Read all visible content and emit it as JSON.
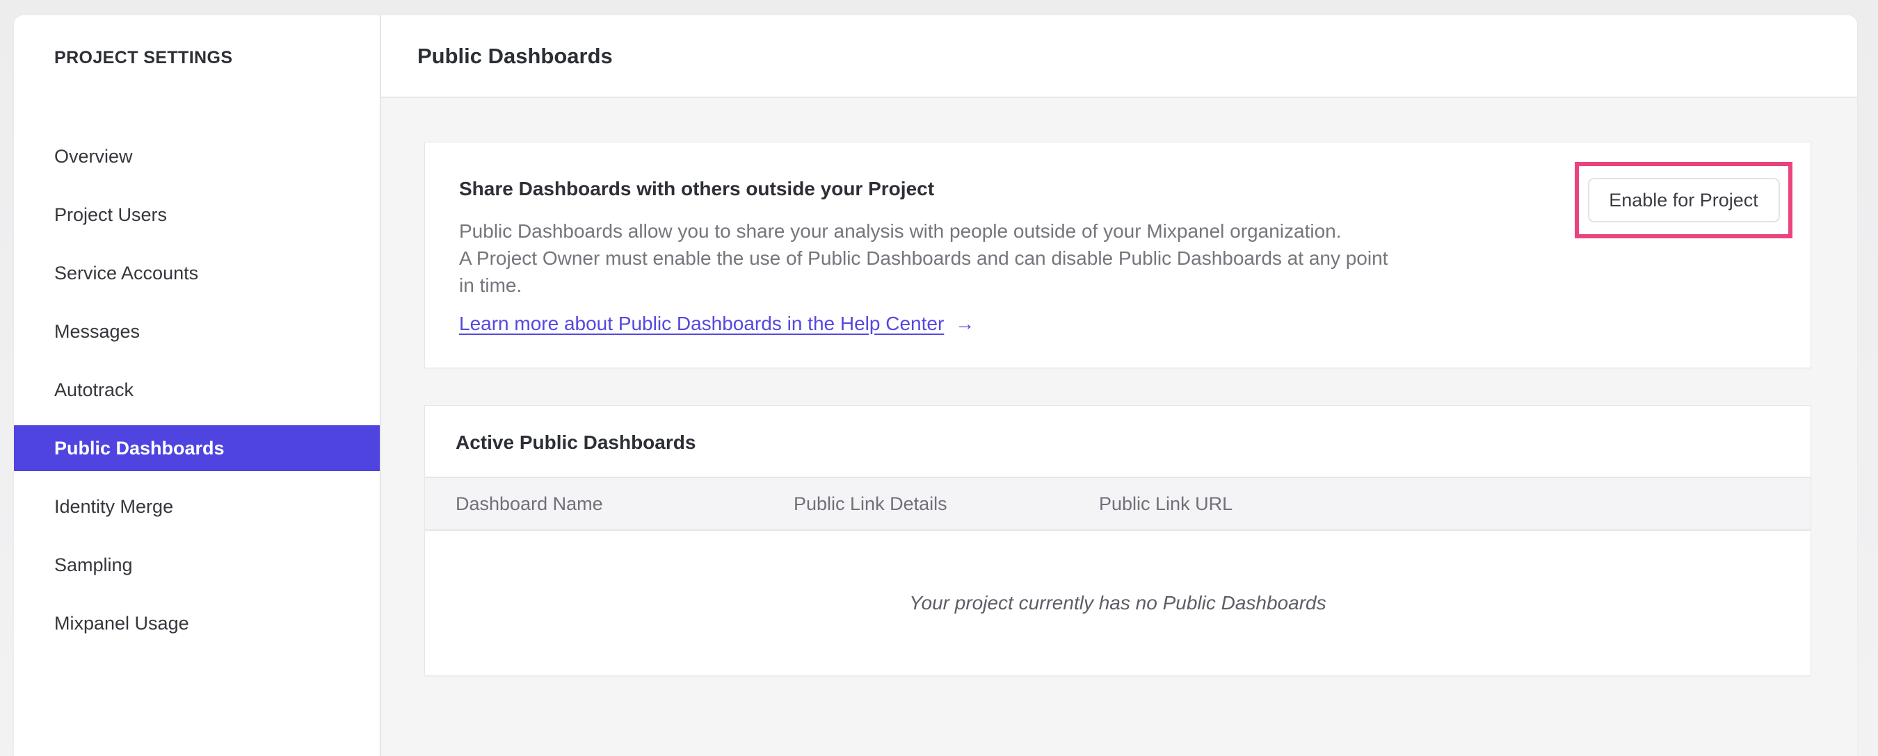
{
  "sidebar": {
    "title": "PROJECT SETTINGS",
    "items": [
      {
        "label": "Overview",
        "active": false
      },
      {
        "label": "Project Users",
        "active": false
      },
      {
        "label": "Service Accounts",
        "active": false
      },
      {
        "label": "Messages",
        "active": false
      },
      {
        "label": "Autotrack",
        "active": false
      },
      {
        "label": "Public Dashboards",
        "active": true
      },
      {
        "label": "Identity Merge",
        "active": false
      },
      {
        "label": "Sampling",
        "active": false
      },
      {
        "label": "Mixpanel Usage",
        "active": false
      }
    ]
  },
  "header": {
    "title": "Public Dashboards"
  },
  "share_card": {
    "title": "Share Dashboards with others outside your Project",
    "description_lines": [
      "Public Dashboards allow you to share your analysis with people outside of your Mixpanel organization.",
      "A Project Owner must enable the use of Public Dashboards and can disable Public Dashboards at any point",
      "in time."
    ],
    "link_label": "Learn more about Public Dashboards in the Help Center",
    "link_arrow": "→",
    "button_label": "Enable for Project"
  },
  "active_card": {
    "title": "Active Public Dashboards",
    "columns": [
      "Dashboard Name",
      "Public Link Details",
      "Public Link URL"
    ],
    "rows": [],
    "empty_message": "Your project currently has no Public Dashboards"
  },
  "colors": {
    "accent": "#4f44e0",
    "link": "#5448e1",
    "annotation_highlight": "#e9447f",
    "content_background": "#f5f5f6"
  }
}
